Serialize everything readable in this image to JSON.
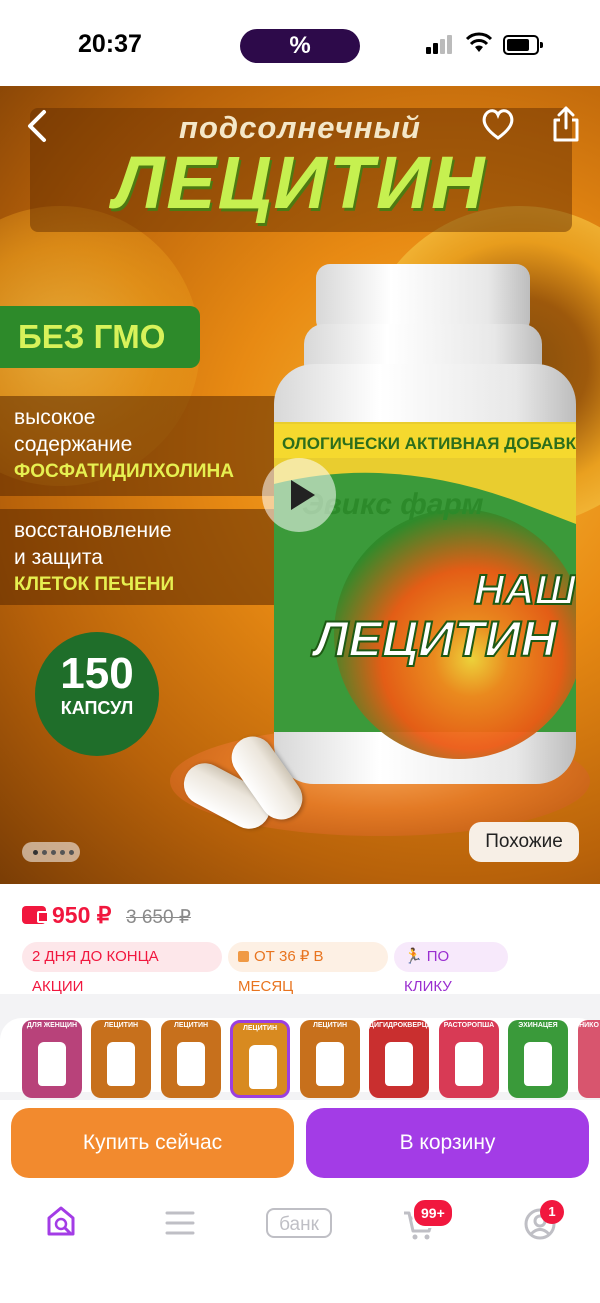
{
  "status_bar": {
    "time": "20:37",
    "center_pill": "%"
  },
  "hero": {
    "subtitle": "подсолнечный",
    "title": "ЛЕЦИТИН",
    "gmo_badge": "БЕЗ ГМО",
    "feature1_line1": "высокое",
    "feature1_line2": "содержание",
    "feature1_highlight": "ФОСФАТИДИЛХОЛИНА",
    "feature2_line1": "восстановление",
    "feature2_line2": "и защита",
    "feature2_highlight": "КЛЕТОК ПЕЧЕНИ",
    "capsules_count": "150",
    "capsules_unit": "КАПСУЛ",
    "jar_band": "ОЛОГИЧЕСКИ АКТИВНАЯ ДОБАВКА",
    "jar_brand": "Эвикс фарм",
    "jar_name1": "НАШ",
    "jar_name2": "ЛЕЦИТИН",
    "similar_button": "Похожие",
    "image_count": 5,
    "current_image": 1
  },
  "price": {
    "current": "950 ₽",
    "old": "3 650 ₽",
    "badges": [
      "2 ДНЯ ДО КОНЦА АКЦИИ",
      "ОТ 36 ₽ В МЕСЯЦ",
      "ПО КЛИКУ"
    ]
  },
  "thumbnails": [
    {
      "label": "ДЛЯ ЖЕНЩИН",
      "color": "#b8427a"
    },
    {
      "label": "ЛЕЦИТИН",
      "color": "#c7701c"
    },
    {
      "label": "ЛЕЦИТИН",
      "color": "#c7701c"
    },
    {
      "label": "ЛЕЦИТИН",
      "color": "#d88a20",
      "selected": true
    },
    {
      "label": "ЛЕЦИТИН",
      "color": "#c7701c"
    },
    {
      "label": "ДИГИДРОКВЕРЦЕТИН",
      "color": "#c92f2f"
    },
    {
      "label": "РАСТОРОПША",
      "color": "#d83a55"
    },
    {
      "label": "ЭХИНАЦЕЯ",
      "color": "#3a9a3a"
    },
    {
      "label": "НИКО",
      "color": "#d8556e"
    }
  ],
  "actions": {
    "buy_now": "Купить сейчас",
    "add_to_cart": "В корзину"
  },
  "bottom_nav": {
    "bank": "банк",
    "cart_badge": "99+",
    "profile_badge": "1"
  },
  "colors": {
    "accent_purple": "#a33ce6",
    "accent_orange": "#f28a2e",
    "price_red": "#f1173e"
  }
}
